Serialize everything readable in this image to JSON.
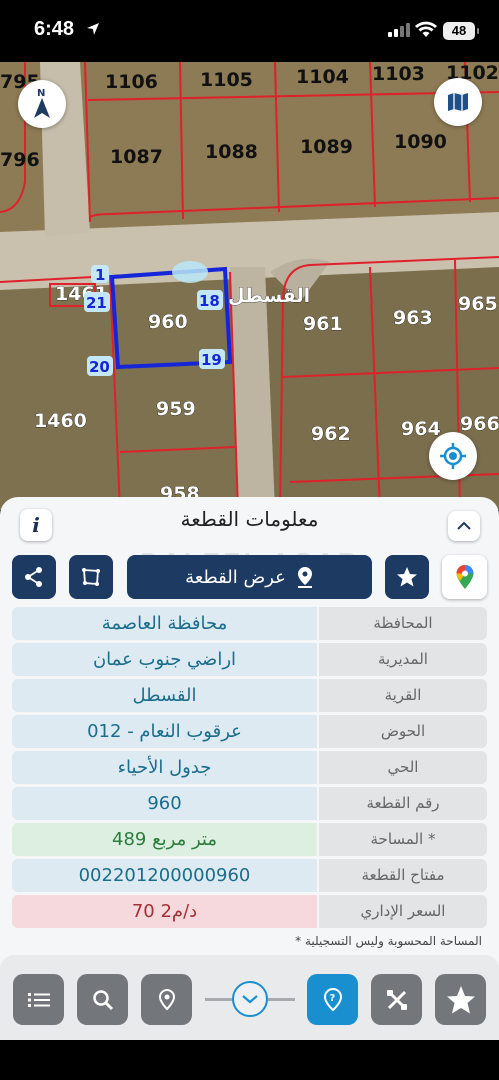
{
  "status_bar": {
    "time": "6:48",
    "battery": "48"
  },
  "map": {
    "parcels": {
      "p1106": "1106",
      "p1105": "1105",
      "p1104": "1104",
      "p1103": "1103",
      "p1102": "1102",
      "p795": "795",
      "p796": "796",
      "p1087": "1087",
      "p1088": "1088",
      "p1089": "1089",
      "p1090": "1090",
      "p1461": "1461",
      "p960": "960",
      "p961": "961",
      "p963": "963",
      "p965": "965",
      "p1460": "1460",
      "p959": "959",
      "p962": "962",
      "p964": "964",
      "p966": "966",
      "p958": "958"
    },
    "street_label": "القسطل",
    "vertices": {
      "v1": "1",
      "v21": "21",
      "v18": "18",
      "v20": "20",
      "v19": "19"
    }
  },
  "panel": {
    "title": "معلومات القطعة",
    "watermark": "DALEEL AQAR",
    "view_parcel_label": "عرض القطعة",
    "rows": [
      {
        "label": "المحافظة",
        "value": "محافظة العاصمة"
      },
      {
        "label": "المديرية",
        "value": "اراضي جنوب عمان"
      },
      {
        "label": "القرية",
        "value": "القسطل"
      },
      {
        "label": "الحوض",
        "value": "عرقوب النعام - 012"
      },
      {
        "label": "الحي",
        "value": "جدول الأحياء"
      },
      {
        "label": "رقم القطعة",
        "value": "960"
      },
      {
        "label": "المساحة *",
        "value": "489  متر مربع"
      },
      {
        "label": "مفتاح القطعة",
        "value": "002201200000960"
      },
      {
        "label": "السعر الإداري",
        "value": "70 د/م2"
      }
    ],
    "note": "* المساحة المحسوبة وليس التسجيلية"
  },
  "colors": {
    "primary_dark": "#1d3a63",
    "accent_blue": "#1a8fd0",
    "parcel_outline": "#e0202a",
    "selected_outline": "#1426d8"
  }
}
